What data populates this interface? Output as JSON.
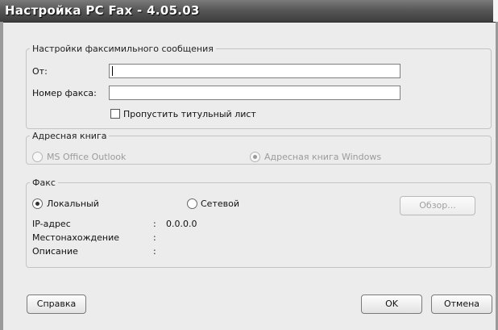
{
  "window": {
    "title": "Настройка PC Fax - 4.05.03"
  },
  "fax_settings": {
    "legend": "Настройки факсимильного сообщения",
    "from_label": "От:",
    "from_value": "",
    "fax_number_label": "Номер факса:",
    "fax_number_value": "",
    "skip_cover_label": "Пропустить титульный лист",
    "skip_cover_checked": false
  },
  "address_book": {
    "legend": "Адресная книга",
    "option_outlook": "MS Office Outlook",
    "option_windows": "Адресная книга Windows",
    "selected": "windows"
  },
  "fax": {
    "legend": "Факс",
    "option_local": "Локальный",
    "option_network": "Сетевой",
    "selected": "local",
    "browse_button": "Обзор...",
    "ip_label": "IP-адрес",
    "ip_value": "0.0.0.0",
    "location_label": "Местонахождение",
    "location_value": "",
    "description_label": "Описание",
    "description_value": "",
    "separator": ":"
  },
  "footer": {
    "help_button": "Справка",
    "ok_button": "OK",
    "cancel_button": "Отмена"
  }
}
